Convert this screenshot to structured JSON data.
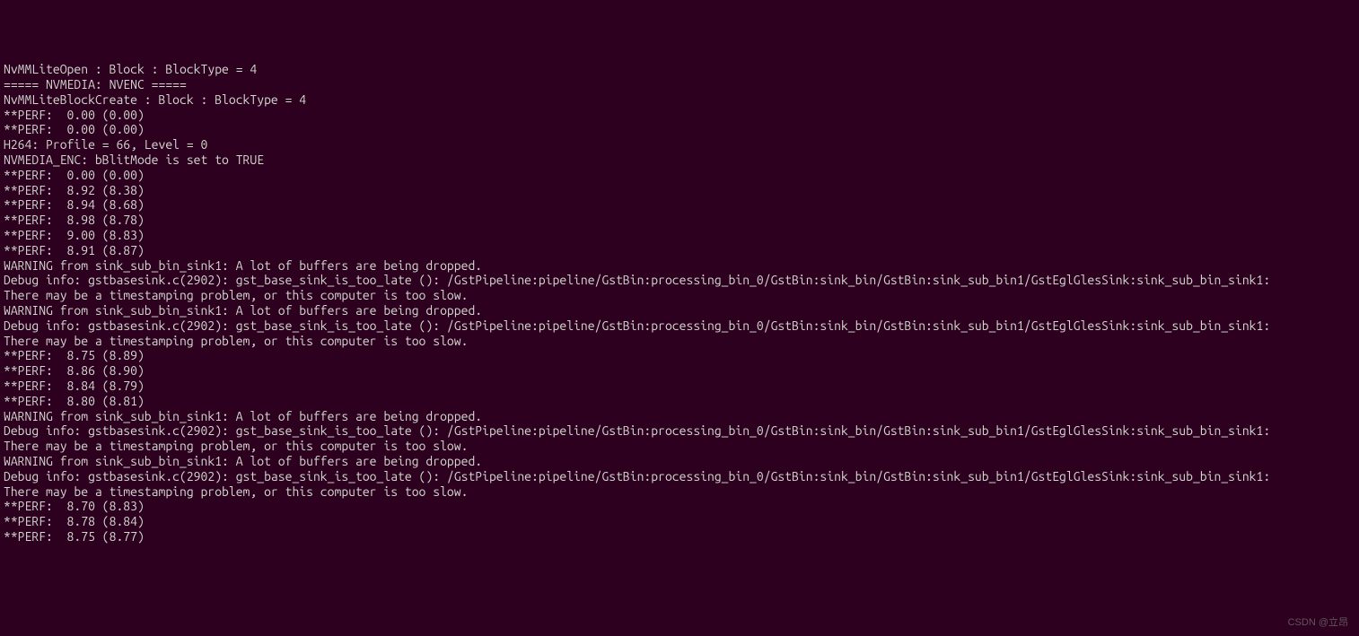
{
  "terminal": {
    "lines": [
      "NvMMLiteOpen : Block : BlockType = 4",
      "===== NVMEDIA: NVENC =====",
      "NvMMLiteBlockCreate : Block : BlockType = 4",
      "**PERF:  0.00 (0.00)",
      "**PERF:  0.00 (0.00)",
      "H264: Profile = 66, Level = 0",
      "NVMEDIA_ENC: bBlitMode is set to TRUE",
      "**PERF:  0.00 (0.00)",
      "**PERF:  8.92 (8.38)",
      "**PERF:  8.94 (8.68)",
      "**PERF:  8.98 (8.78)",
      "**PERF:  9.00 (8.83)",
      "**PERF:  8.91 (8.87)",
      "WARNING from sink_sub_bin_sink1: A lot of buffers are being dropped.",
      "Debug info: gstbasesink.c(2902): gst_base_sink_is_too_late (): /GstPipeline:pipeline/GstBin:processing_bin_0/GstBin:sink_bin/GstBin:sink_sub_bin1/GstEglGlesSink:sink_sub_bin_sink1:",
      "There may be a timestamping problem, or this computer is too slow.",
      "WARNING from sink_sub_bin_sink1: A lot of buffers are being dropped.",
      "Debug info: gstbasesink.c(2902): gst_base_sink_is_too_late (): /GstPipeline:pipeline/GstBin:processing_bin_0/GstBin:sink_bin/GstBin:sink_sub_bin1/GstEglGlesSink:sink_sub_bin_sink1:",
      "There may be a timestamping problem, or this computer is too slow.",
      "**PERF:  8.75 (8.89)",
      "**PERF:  8.86 (8.90)",
      "**PERF:  8.84 (8.79)",
      "**PERF:  8.80 (8.81)",
      "WARNING from sink_sub_bin_sink1: A lot of buffers are being dropped.",
      "Debug info: gstbasesink.c(2902): gst_base_sink_is_too_late (): /GstPipeline:pipeline/GstBin:processing_bin_0/GstBin:sink_bin/GstBin:sink_sub_bin1/GstEglGlesSink:sink_sub_bin_sink1:",
      "There may be a timestamping problem, or this computer is too slow.",
      "WARNING from sink_sub_bin_sink1: A lot of buffers are being dropped.",
      "Debug info: gstbasesink.c(2902): gst_base_sink_is_too_late (): /GstPipeline:pipeline/GstBin:processing_bin_0/GstBin:sink_bin/GstBin:sink_sub_bin1/GstEglGlesSink:sink_sub_bin_sink1:",
      "There may be a timestamping problem, or this computer is too slow.",
      "**PERF:  8.70 (8.83)",
      "**PERF:  8.78 (8.84)",
      "**PERF:  8.75 (8.77)"
    ]
  },
  "watermark": "CSDN @立昂"
}
